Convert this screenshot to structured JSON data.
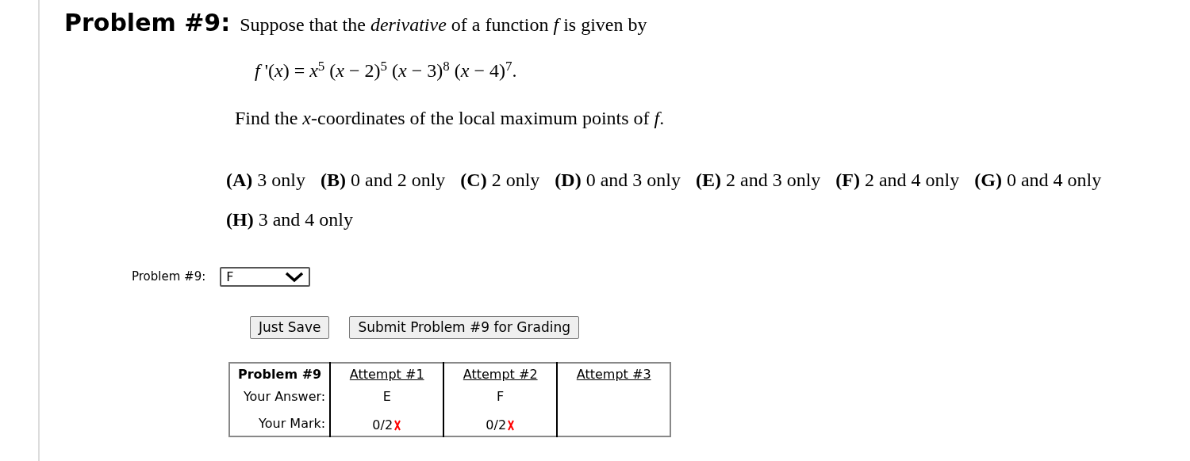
{
  "problem": {
    "heading": "Problem #9:",
    "statement": "Suppose that the *derivative* of a function *f* is given by",
    "equation": "*f* '(*x*) = *x*$^{5}$ (*x* − 2)$^{5}$ (*x* − 3)$^{8}$ (*x* − 4)$^{7}$.",
    "question": "Find the *x*-coordinates of the local maximum points of *f*.",
    "choices": [
      {
        "letter": "(A)",
        "text": "3 only"
      },
      {
        "letter": "(B)",
        "text": "0 and 2 only"
      },
      {
        "letter": "(C)",
        "text": "2 only"
      },
      {
        "letter": "(D)",
        "text": "0 and 3 only"
      },
      {
        "letter": "(E)",
        "text": "2 and 3 only"
      },
      {
        "letter": "(F)",
        "text": "2 and 4 only"
      },
      {
        "letter": "(G)",
        "text": "0 and 4 only"
      },
      {
        "letter": "(H)",
        "text": "3 and 4 only"
      }
    ]
  },
  "answer": {
    "label": "Problem #9:",
    "value": "F"
  },
  "buttons": [
    "Just Save",
    "Submit Problem #9 for Grading"
  ],
  "attempts_table": {
    "header": "Problem #9",
    "row_labels": [
      "Your Answer:",
      "Your Mark:"
    ],
    "attempts": [
      {
        "title": "Attempt #1",
        "answer": "E",
        "mark": "0/2",
        "correct": false
      },
      {
        "title": "Attempt #2",
        "answer": "F",
        "mark": "0/2",
        "correct": false
      },
      {
        "title": "Attempt #3"
      }
    ]
  }
}
